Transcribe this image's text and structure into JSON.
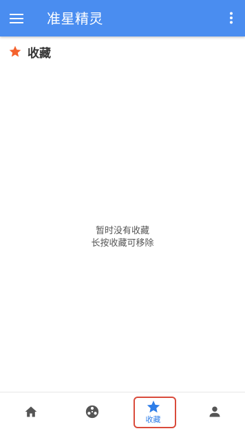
{
  "app": {
    "title": "准星精灵",
    "theme_color": "#4a8df0"
  },
  "appbar": {
    "menu_icon": "menu-icon",
    "more_icon": "more-vertical-icon"
  },
  "section": {
    "icon": "star-icon",
    "icon_color": "#f4622d",
    "title": "收藏"
  },
  "empty_state": {
    "line1": "暂时没有收藏",
    "line2": "长按收藏可移除"
  },
  "bottom_nav": {
    "items": [
      {
        "icon": "home-icon",
        "label": "",
        "active": false
      },
      {
        "icon": "crosshair-icon",
        "label": "",
        "active": false
      },
      {
        "icon": "star-icon",
        "label": "收藏",
        "active": true
      },
      {
        "icon": "person-icon",
        "label": "",
        "active": false
      }
    ],
    "active_color": "#2f7ee8",
    "inactive_color": "#555555",
    "highlight_frame_color": "#d94a3a"
  }
}
